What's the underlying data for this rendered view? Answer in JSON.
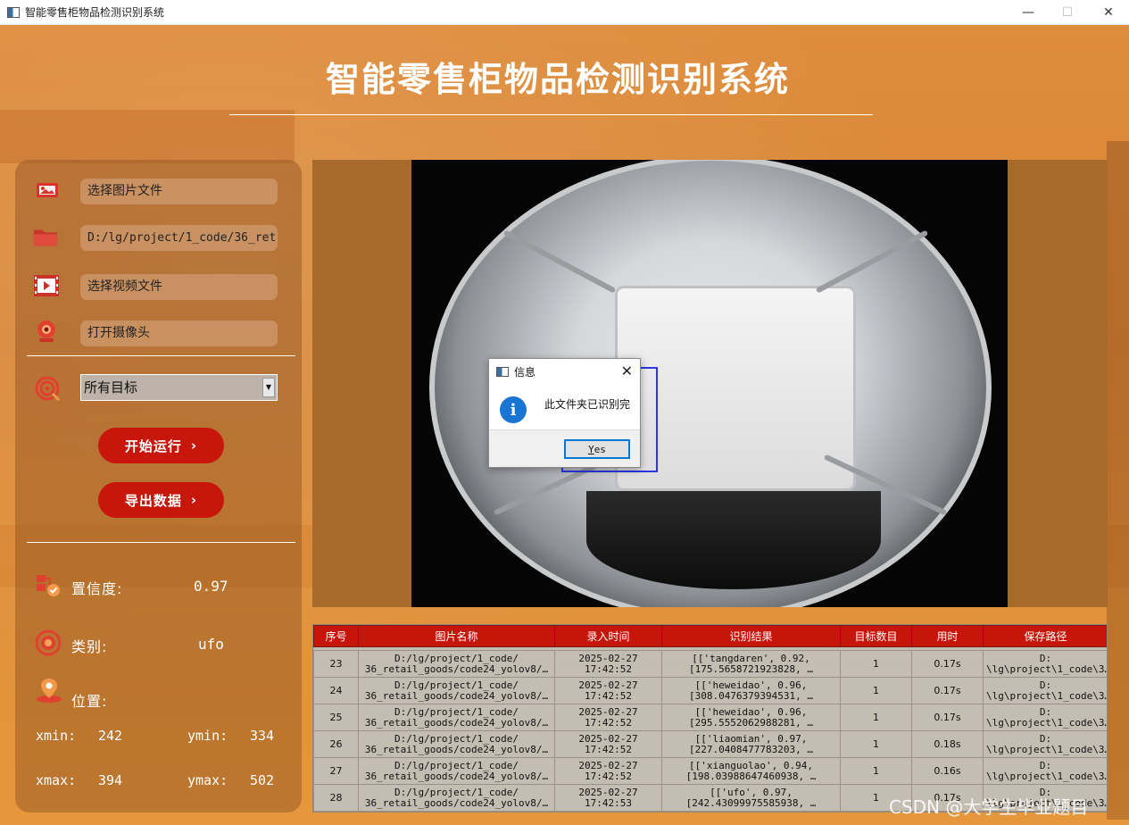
{
  "window": {
    "title": "智能零售柜物品检测识别系统",
    "controls": {
      "minimize": "—",
      "maximize": "☐",
      "close": "✕"
    }
  },
  "header": {
    "title": "智能零售柜物品检测识别系统"
  },
  "left_panel": {
    "select_image_label": "选择图片文件",
    "folder_path": "D:/lg/project/1_code/36_ret",
    "select_video_label": "选择视频文件",
    "open_camera_label": "打开摄像头",
    "target_select": {
      "selected": "所有目标"
    },
    "start_button": "开始运行",
    "export_button": "导出数据",
    "button_chevron": "›",
    "confidence_label": "置信度:",
    "confidence_value": "0.97",
    "class_label": "类别:",
    "class_value": "ufo",
    "position_label": "位置:",
    "xmin_label": "xmin:",
    "xmin_value": "242",
    "ymin_label": "ymin:",
    "ymin_value": "334",
    "xmax_label": "xmax:",
    "xmax_value": "394",
    "ymax_label": "ymax:",
    "ymax_value": "502"
  },
  "dialog": {
    "title": "信息",
    "close": "✕",
    "icon_letter": "i",
    "message": "此文件夹已识别完",
    "button": {
      "underlined": "Y",
      "rest": "es"
    }
  },
  "table": {
    "headers": [
      "序号",
      "图片名称",
      "录入时间",
      "识别结果",
      "目标数目",
      "用时",
      "保存路径"
    ],
    "rows": [
      {
        "id": "23",
        "name1": "D:/lg/project/1_code/",
        "name2": "36_retail_goods/code24_yolov8/…",
        "date": "2025-02-27",
        "time": "17:42:52",
        "res1": "[['tangdaren', 0.92,",
        "res2": "[175.5658721923828, …",
        "count": "1",
        "dur": "0.17s",
        "path1": "D:",
        "path2": "\\lg\\project\\1_code\\3…"
      },
      {
        "id": "24",
        "name1": "D:/lg/project/1_code/",
        "name2": "36_retail_goods/code24_yolov8/…",
        "date": "2025-02-27",
        "time": "17:42:52",
        "res1": "[['heweidao', 0.96,",
        "res2": "[308.0476379394531, …",
        "count": "1",
        "dur": "0.17s",
        "path1": "D:",
        "path2": "\\lg\\project\\1_code\\3…"
      },
      {
        "id": "25",
        "name1": "D:/lg/project/1_code/",
        "name2": "36_retail_goods/code24_yolov8/…",
        "date": "2025-02-27",
        "time": "17:42:52",
        "res1": "[['heweidao', 0.96,",
        "res2": "[295.5552062988281, …",
        "count": "1",
        "dur": "0.17s",
        "path1": "D:",
        "path2": "\\lg\\project\\1_code\\3…"
      },
      {
        "id": "26",
        "name1": "D:/lg/project/1_code/",
        "name2": "36_retail_goods/code24_yolov8/…",
        "date": "2025-02-27",
        "time": "17:42:52",
        "res1": "[['liaomian', 0.97,",
        "res2": "[227.0408477783203, …",
        "count": "1",
        "dur": "0.18s",
        "path1": "D:",
        "path2": "\\lg\\project\\1_code\\3…"
      },
      {
        "id": "27",
        "name1": "D:/lg/project/1_code/",
        "name2": "36_retail_goods/code24_yolov8/…",
        "date": "2025-02-27",
        "time": "17:42:52",
        "res1": "[['xianguolao', 0.94,",
        "res2": "[198.03988647460938, …",
        "count": "1",
        "dur": "0.16s",
        "path1": "D:",
        "path2": "\\lg\\project\\1_code\\3…"
      },
      {
        "id": "28",
        "name1": "D:/lg/project/1_code/",
        "name2": "36_retail_goods/code24_yolov8/…",
        "date": "2025-02-27",
        "time": "17:42:53",
        "res1": "[['ufo', 0.97,",
        "res2": "[242.43099975585938, …",
        "count": "1",
        "dur": "0.17s",
        "path1": "D:",
        "path2": "\\lg\\project\\1_code\\3…"
      }
    ]
  },
  "watermark": "CSDN @大学生毕业题目"
}
